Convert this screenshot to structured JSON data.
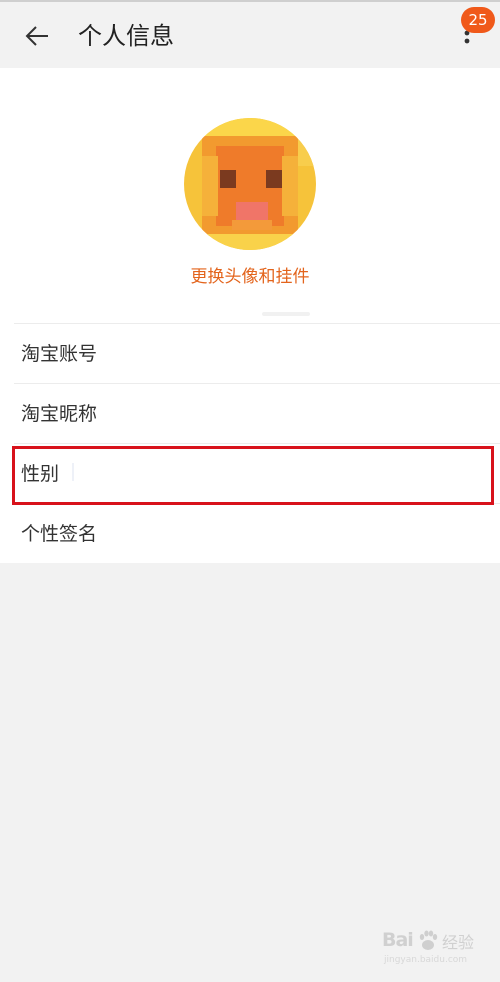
{
  "header": {
    "title": "个人信息",
    "badge_count": "25"
  },
  "avatar": {
    "change_label": "更换头像和挂件"
  },
  "list": {
    "items": [
      {
        "label": "淘宝账号"
      },
      {
        "label": "淘宝昵称"
      },
      {
        "label": "性别"
      },
      {
        "label": "个性签名"
      }
    ]
  },
  "colors": {
    "accent": "#e3641c",
    "badge": "#f0591a",
    "highlight": "#d8121b"
  },
  "icons": {
    "back": "arrow-left-icon",
    "more": "more-vertical-icon"
  },
  "watermark": {
    "brand": "Bai",
    "jingyan": "经验",
    "url": "jingyan.baidu.com"
  }
}
